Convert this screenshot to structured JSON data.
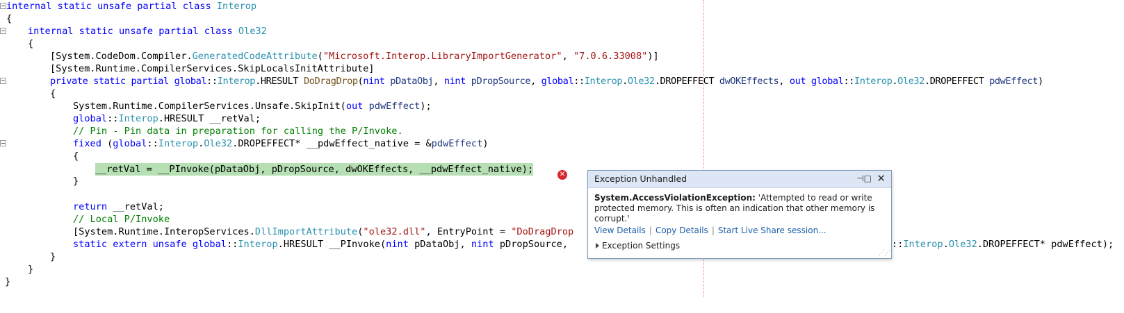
{
  "code": {
    "l1": {
      "kw": "internal static unsafe partial class ",
      "type": "Interop"
    },
    "l2": "{",
    "l3": {
      "kw": "internal static unsafe partial class ",
      "type": "Ole32"
    },
    "l4": "{",
    "l5": {
      "a": "[System.CodeDom.Compiler.",
      "b": "GeneratedCodeAttribute",
      "c": "(",
      "s1": "\"Microsoft.Interop.LibraryImportGenerator\"",
      "d": ", ",
      "s2": "\"7.0.6.33008\"",
      "e": ")]"
    },
    "l6": "[System.Runtime.CompilerServices.SkipLocalsInitAttribute]",
    "l7": {
      "kw1": "private static partial ",
      "kw2": "global",
      "a": "::",
      "t1": "Interop",
      "b": ".HRESULT ",
      "m": "DoDragDrop",
      "c": "(",
      "kw3": "nint ",
      "p1": "pDataObj",
      "d": ", ",
      "kw4": "nint ",
      "p2": "pDropSource",
      "e": ", ",
      "kw5": "global",
      "f": "::",
      "t2": "Interop",
      "g": ".",
      "t3": "Ole32",
      "h": ".DROPEFFECT ",
      "p3": "dwOKEffects",
      "i": ", ",
      "kw6": "out ",
      "kw7": "global",
      "j": "::",
      "t4": "Interop",
      "k": ".",
      "t5": "Ole32",
      "l": ".DROPEFFECT ",
      "p4": "pdwEffect",
      "z": ")"
    },
    "l8": "{",
    "l9": {
      "a": "System.Runtime.CompilerServices.Unsafe.SkipInit(",
      "kw": "out ",
      "p": "pdwEffect",
      "b": ");"
    },
    "l10": {
      "kw": "global",
      "a": "::",
      "t": "Interop",
      "b": ".HRESULT __retVal;"
    },
    "l11": "// Pin - Pin data in preparation for calling the P/Invoke.",
    "l12": {
      "kw": "fixed ",
      "a": "(",
      "kw2": "global",
      "b": "::",
      "t1": "Interop",
      "c": ".",
      "t2": "Ole32",
      "d": ".DROPEFFECT* __pdwEffect_native = &",
      "p": "pdwEffect",
      "e": ")"
    },
    "l13": "{",
    "l14": "__retVal = __PInvoke(pDataObj, pDropSource, dwOKEffects, __pdwEffect_native);",
    "l15": "}",
    "l17": {
      "kw": "return ",
      "a": "__retVal;"
    },
    "l18": "// Local P/Invoke",
    "l19": {
      "a": "[System.Runtime.InteropServices.",
      "t": "DllImportAttribute",
      "b": "(",
      "s1": "\"ole32.dll\"",
      "c": ", EntryPoint = ",
      "s2": "\"DoDragDrop"
    },
    "l20": {
      "kw": "static extern unsafe ",
      "kw2": "global",
      "a": "::",
      "t": "Interop",
      "b": ".HRESULT __PInvoke(",
      "kw3": "nint ",
      "c": "pDataObj, ",
      "kw4": "nint ",
      "d": "pDropSource,"
    },
    "l20_tail": {
      "a": "::",
      "t1": "Interop",
      "b": ".",
      "t2": "Ole32",
      "c": ".DROPEFFECT* pdwEffect);"
    },
    "l21": "}",
    "l22": "}",
    "l23": "}"
  },
  "error_icon": "error-x-icon",
  "popup": {
    "title": "Exception Unhandled",
    "pin_glyph": "⊣□",
    "close_glyph": "✕",
    "exception_type": "System.AccessViolationException:",
    "exception_message": " 'Attempted to read or write protected memory. This is often an indication that other memory is corrupt.'",
    "link_view": "View Details",
    "link_copy": "Copy Details",
    "link_share": "Start Live Share session...",
    "settings": "Exception Settings",
    "grip": "⋰⋰"
  },
  "colors": {
    "keyword": "#0000ff",
    "type": "#2b91af",
    "string": "#a31515",
    "comment": "#008000",
    "highlight": "#b6dfb3"
  }
}
